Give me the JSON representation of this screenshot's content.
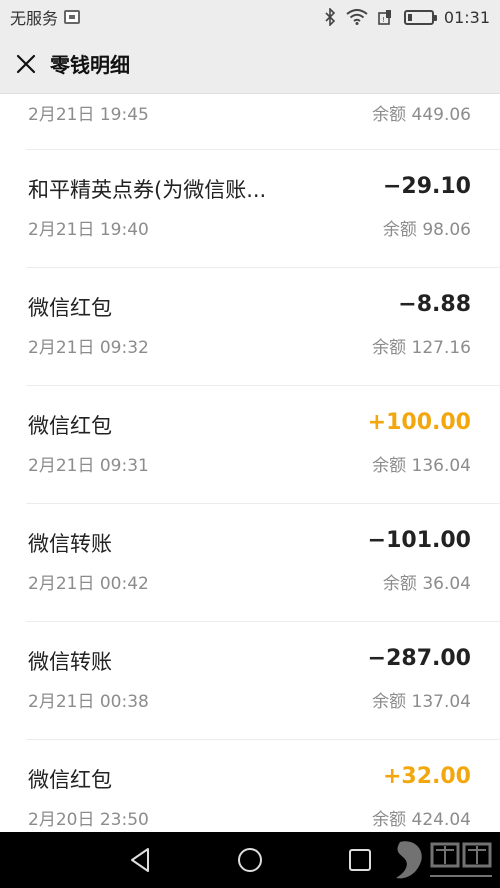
{
  "status_bar": {
    "carrier": "无服务",
    "time": "01:31",
    "icons": [
      "sim-icon",
      "bluetooth-icon",
      "wifi-icon",
      "signal-icon",
      "battery-icon"
    ]
  },
  "header": {
    "title": "零钱明细",
    "close_icon": "close-icon"
  },
  "transactions": [
    {
      "title": "",
      "amount": "",
      "type": "",
      "date": "2月21日 19:45",
      "balance": "余额 449.06"
    },
    {
      "title": "和平精英点券(为微信账...",
      "amount": "−29.10",
      "type": "expense",
      "date": "2月21日 19:40",
      "balance": "余额 98.06"
    },
    {
      "title": "微信红包",
      "amount": "−8.88",
      "type": "expense",
      "date": "2月21日 09:32",
      "balance": "余额 127.16"
    },
    {
      "title": "微信红包",
      "amount": "+100.00",
      "type": "income",
      "date": "2月21日 09:31",
      "balance": "余额 136.04"
    },
    {
      "title": "微信转账",
      "amount": "−101.00",
      "type": "expense",
      "date": "2月21日 00:42",
      "balance": "余额 36.04"
    },
    {
      "title": "微信转账",
      "amount": "−287.00",
      "type": "expense",
      "date": "2月21日 00:38",
      "balance": "余额 137.04"
    },
    {
      "title": "微信红包",
      "amount": "+32.00",
      "type": "income",
      "date": "2月20日 23:50",
      "balance": "余额 424.04"
    }
  ],
  "colors": {
    "income": "#f2a70e",
    "expense": "#222222",
    "secondary_text": "#8c8c8c",
    "header_bg": "#ededed"
  },
  "nav_bar": {
    "icons": [
      "back-icon",
      "home-icon",
      "recents-icon"
    ]
  }
}
